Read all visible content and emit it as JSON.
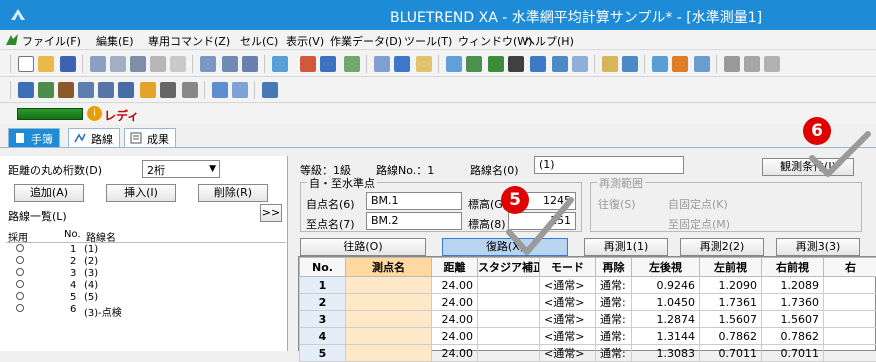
{
  "window": {
    "title": "BLUETREND XA - 水準網平均計算サンプル* - [水準測量1]"
  },
  "menu": [
    "ファイル(F)",
    "編集(E)",
    "専用コマンド(Z)",
    "セル(C)",
    "表示(V)",
    "作業データ(D)",
    "ツール(T)",
    "ウィンドウ(W)",
    "ヘルプ(H)"
  ],
  "status": {
    "text": "レディ"
  },
  "tabs": [
    "手簿",
    "路線",
    "成果"
  ],
  "left": {
    "rounding_label": "距離の丸め桁数(D)",
    "rounding_value": "2桁",
    "add_button": "追加(A)",
    "insert_button": "挿入(I)",
    "delete_button": "削除(R)",
    "route_list_label": "路線一覧(L)",
    "expand_button": ">>",
    "columns": [
      "採用",
      "No.",
      "路線名"
    ],
    "routes": [
      {
        "no": "1",
        "name": "(1)"
      },
      {
        "no": "2",
        "name": "(2)"
      },
      {
        "no": "3",
        "name": "(3)"
      },
      {
        "no": "4",
        "name": "(4)"
      },
      {
        "no": "5",
        "name": "(5)"
      },
      {
        "no": "6",
        "name": "(3)-点検"
      }
    ]
  },
  "header": {
    "grade": "等級：1級",
    "route_no": "路線No.：1",
    "route_name_label": "路線名(0)",
    "route_name_value": "(1)",
    "obs_conditions_button": "観測条件(J)"
  },
  "benchmark": {
    "legend": "自・至水準点",
    "from_label": "自点名(6)",
    "from_value": "BM.1",
    "from_elev_label": "標高(G)",
    "from_elev_value": "1245",
    "to_label": "至点名(7)",
    "to_value": "BM.2",
    "to_elev_label": "標高(8)",
    "to_elev_value": ".151"
  },
  "remeasure": {
    "legend": "再測範囲",
    "round_trip": "往復(S)",
    "from_fixed": "自固定点(K)",
    "to_fixed": "至固定点(M)"
  },
  "run_buttons": [
    "往路(O)",
    "復路(X)",
    "再測1(1)",
    "再測2(2)",
    "再測3(3)"
  ],
  "grid": {
    "columns": [
      "No.",
      "測点名",
      "距離",
      "スタジア補正",
      "モード",
      "再除",
      "左後視",
      "左前視",
      "右前視",
      "右"
    ],
    "rows": [
      {
        "no": "1",
        "name": "",
        "dist": "24.00",
        "stadia": "",
        "mode": "<通常>",
        "re": "通常:",
        "lb": "0.9246",
        "lf": "1.2090",
        "rf": "1.2089"
      },
      {
        "no": "2",
        "name": "",
        "dist": "24.00",
        "stadia": "",
        "mode": "<通常>",
        "re": "通常:",
        "lb": "1.0450",
        "lf": "1.7361",
        "rf": "1.7360"
      },
      {
        "no": "3",
        "name": "",
        "dist": "24.00",
        "stadia": "",
        "mode": "<通常>",
        "re": "通常:",
        "lb": "1.2874",
        "lf": "1.5607",
        "rf": "1.5607"
      },
      {
        "no": "4",
        "name": "",
        "dist": "24.00",
        "stadia": "",
        "mode": "<通常>",
        "re": "通常:",
        "lb": "1.3144",
        "lf": "0.7862",
        "rf": "0.7862"
      },
      {
        "no": "5",
        "name": "",
        "dist": "24.00",
        "stadia": "",
        "mode": "<通常>",
        "re": "通常:",
        "lb": "1.3083",
        "lf": "0.7011",
        "rf": "0.7011"
      }
    ]
  },
  "annotations": {
    "step5": "5",
    "step6": "6"
  },
  "colors": {
    "title_bar": "#1e8bd6",
    "annotation_red": "#e00000",
    "annotation_check": "#9a9a9a",
    "active_button": "#b8d4f0"
  }
}
